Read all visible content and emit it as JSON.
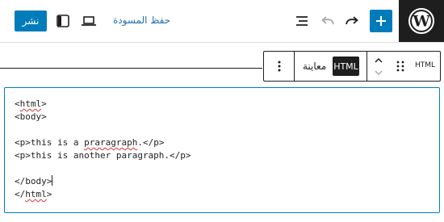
{
  "header": {
    "publish_label": "نشر",
    "save_draft_label": "حفظ المسودة",
    "icons": {
      "logo": "wordpress-logo",
      "add": "plus-icon",
      "redo": "redo-icon",
      "undo": "undo-icon",
      "document_overview": "list-view-icon",
      "settings": "settings-sidebar-icon",
      "preview": "laptop-icon"
    }
  },
  "block_toolbar": {
    "preview_label": "معاينة",
    "html_mode_label": "HTML",
    "block_type_label": "HTML",
    "icons": {
      "more": "more-vertical-icon",
      "move_up": "chevron-up-icon",
      "move_down": "chevron-down-icon",
      "drag": "drag-handle-icon"
    }
  },
  "code": {
    "lines": [
      "<html>",
      "<body>",
      "",
      "<p>this is a praragraph.</p>",
      "<p>this is another paragraph.</p>",
      "",
      "</body>",
      "</html>"
    ],
    "spellcheck_words": [
      "html",
      "praragraph",
      "html"
    ]
  },
  "colors": {
    "accent": "#007cba",
    "dark": "#1e1e1e",
    "link": "#2271b1",
    "spellcheck": "#d63638"
  }
}
